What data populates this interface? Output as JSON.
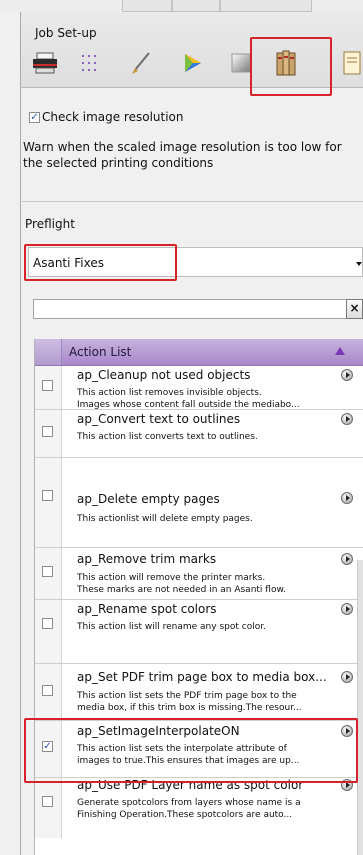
{
  "panel": {
    "title": "Job Set-up"
  },
  "toolbar": {
    "icons": [
      "printer-icon",
      "grid-icon",
      "brush-icon",
      "color-wheel-icon",
      "books-icon",
      "document-icon"
    ],
    "selected": "books-icon"
  },
  "resolution": {
    "check_label": "Check image resolution",
    "checked": true,
    "warn_line1": "Warn when the scaled image resolution is too low for",
    "warn_line2": "the selected printing conditions"
  },
  "preflight": {
    "section_label": "Preflight",
    "selected_value": "Asanti Fixes"
  },
  "search": {
    "value": "",
    "placeholder": "",
    "clear_label": "×"
  },
  "action_list": {
    "header": "Action List",
    "items": [
      {
        "title": "ap_Cleanup not used objects",
        "desc": "This action list removes invisible objects.\nImages whose content fall outside the mediabo...",
        "checked": false
      },
      {
        "title": "ap_Convert text to outlines",
        "desc": "This action list converts text to outlines.",
        "checked": false
      },
      {
        "title": "ap_Delete empty pages",
        "desc": "This actionlist will delete empty pages.",
        "checked": false
      },
      {
        "title": "ap_Remove trim marks",
        "desc": "This action will remove the printer marks.\nThese marks are not needed in an Asanti flow.",
        "checked": false
      },
      {
        "title": "ap_Rename spot colors",
        "desc": "This action list will rename any spot color.",
        "checked": false
      },
      {
        "title": "ap_Set PDF trim page box to media box...",
        "desc": "This action list sets the PDF trim page box to the\nmedia box, if this trim box is missing.The resour...",
        "checked": false
      },
      {
        "title": "ap_SetImageInterpolateON",
        "desc": "This action list sets the interpolate attribute of\nimages to true.This ensures that images are up...",
        "checked": true
      },
      {
        "title": "ap_Use PDF Layer name as spot color",
        "desc": "Generate spotcolors from layers whose name is a\nFinishing Operation.These spotcolors are auto...",
        "checked": false
      }
    ]
  },
  "colors": {
    "highlight": "#d8222a",
    "list_header": "#b59bd2",
    "check_mark": "#2b55b8"
  }
}
